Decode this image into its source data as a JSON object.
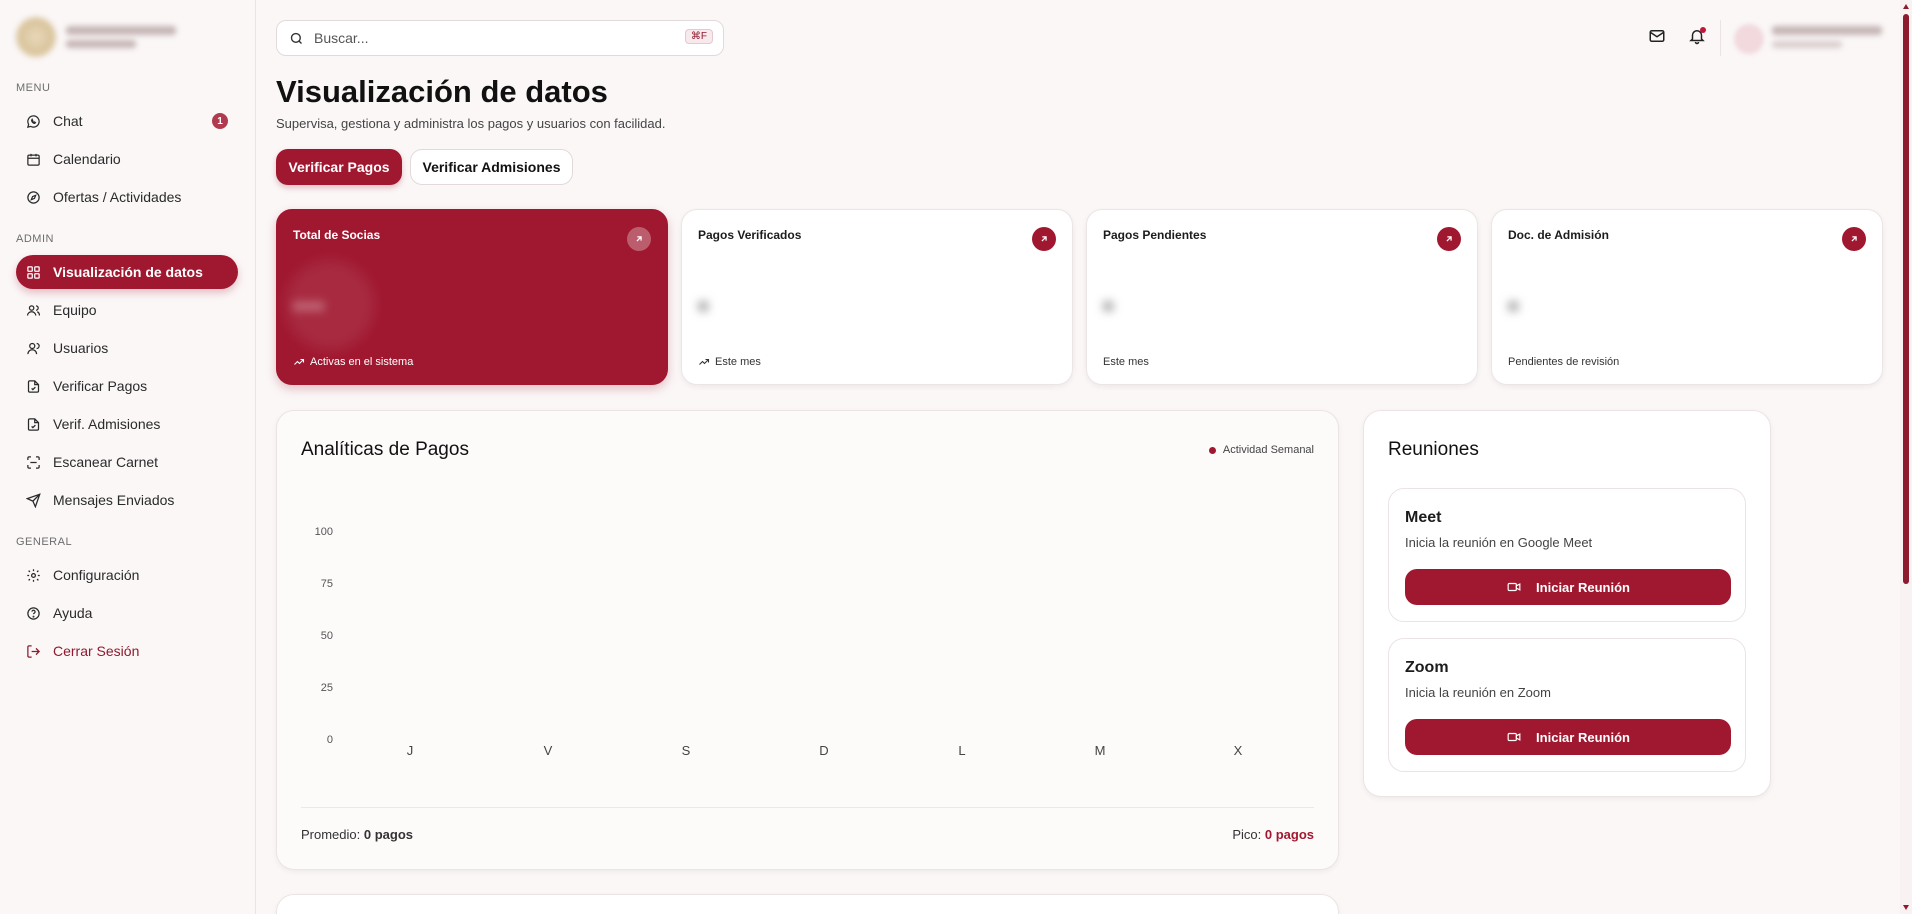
{
  "sidebar": {
    "sections": {
      "menu": "MENU",
      "admin": "ADMIN",
      "general": "GENERAL"
    },
    "menu_items": [
      {
        "label": "Chat",
        "badge": "1"
      },
      {
        "label": "Calendario"
      },
      {
        "label": "Ofertas / Actividades"
      }
    ],
    "admin_items": [
      {
        "label": "Visualización de datos"
      },
      {
        "label": "Equipo"
      },
      {
        "label": "Usuarios"
      },
      {
        "label": "Verificar Pagos"
      },
      {
        "label": "Verif. Admisiones"
      },
      {
        "label": "Escanear Carnet"
      },
      {
        "label": "Mensajes Enviados"
      }
    ],
    "general_items": [
      {
        "label": "Configuración"
      },
      {
        "label": "Ayuda"
      },
      {
        "label": "Cerrar Sesión"
      }
    ]
  },
  "header": {
    "search_placeholder": "Buscar...",
    "search_shortcut": "⌘F"
  },
  "page": {
    "title": "Visualización de datos",
    "subtitle": "Supervisa, gestiona y administra los pagos y usuarios con facilidad.",
    "tab_primary": "Verificar Pagos",
    "tab_secondary": "Verificar Admisiones"
  },
  "stats": [
    {
      "title": "Total de Socias",
      "footer": "Activas en el sistema"
    },
    {
      "title": "Pagos Verificados",
      "footer": "Este mes"
    },
    {
      "title": "Pagos Pendientes",
      "footer": "Este mes"
    },
    {
      "title": "Doc. de Admisión",
      "footer": "Pendientes de revisión"
    }
  ],
  "chart": {
    "title": "Analíticas de Pagos",
    "legend": "Actividad Semanal",
    "footer_avg_label": "Promedio:",
    "footer_avg_value": "0 pagos",
    "footer_peak_label": "Pico:",
    "footer_peak_value": "0 pagos"
  },
  "chart_data": {
    "type": "bar",
    "categories": [
      "J",
      "V",
      "S",
      "D",
      "L",
      "M",
      "X"
    ],
    "values": [
      0,
      0,
      0,
      0,
      0,
      0,
      0
    ],
    "yticks": [
      0,
      25,
      50,
      75,
      100
    ],
    "ylim": [
      0,
      100
    ],
    "title": "Analíticas de Pagos",
    "legend_position": "top-right",
    "grid": false,
    "series": [
      {
        "name": "Actividad Semanal",
        "values": [
          0,
          0,
          0,
          0,
          0,
          0,
          0
        ]
      }
    ]
  },
  "meetings": {
    "title": "Reuniones",
    "items": [
      {
        "name": "Meet",
        "description": "Inicia la reunión en Google Meet",
        "button": "Iniciar Reunión"
      },
      {
        "name": "Zoom",
        "description": "Inicia la reunión en Zoom",
        "button": "Iniciar Reunión"
      }
    ]
  },
  "colors": {
    "accent": "#a01830",
    "background": "#fbf7f7"
  }
}
